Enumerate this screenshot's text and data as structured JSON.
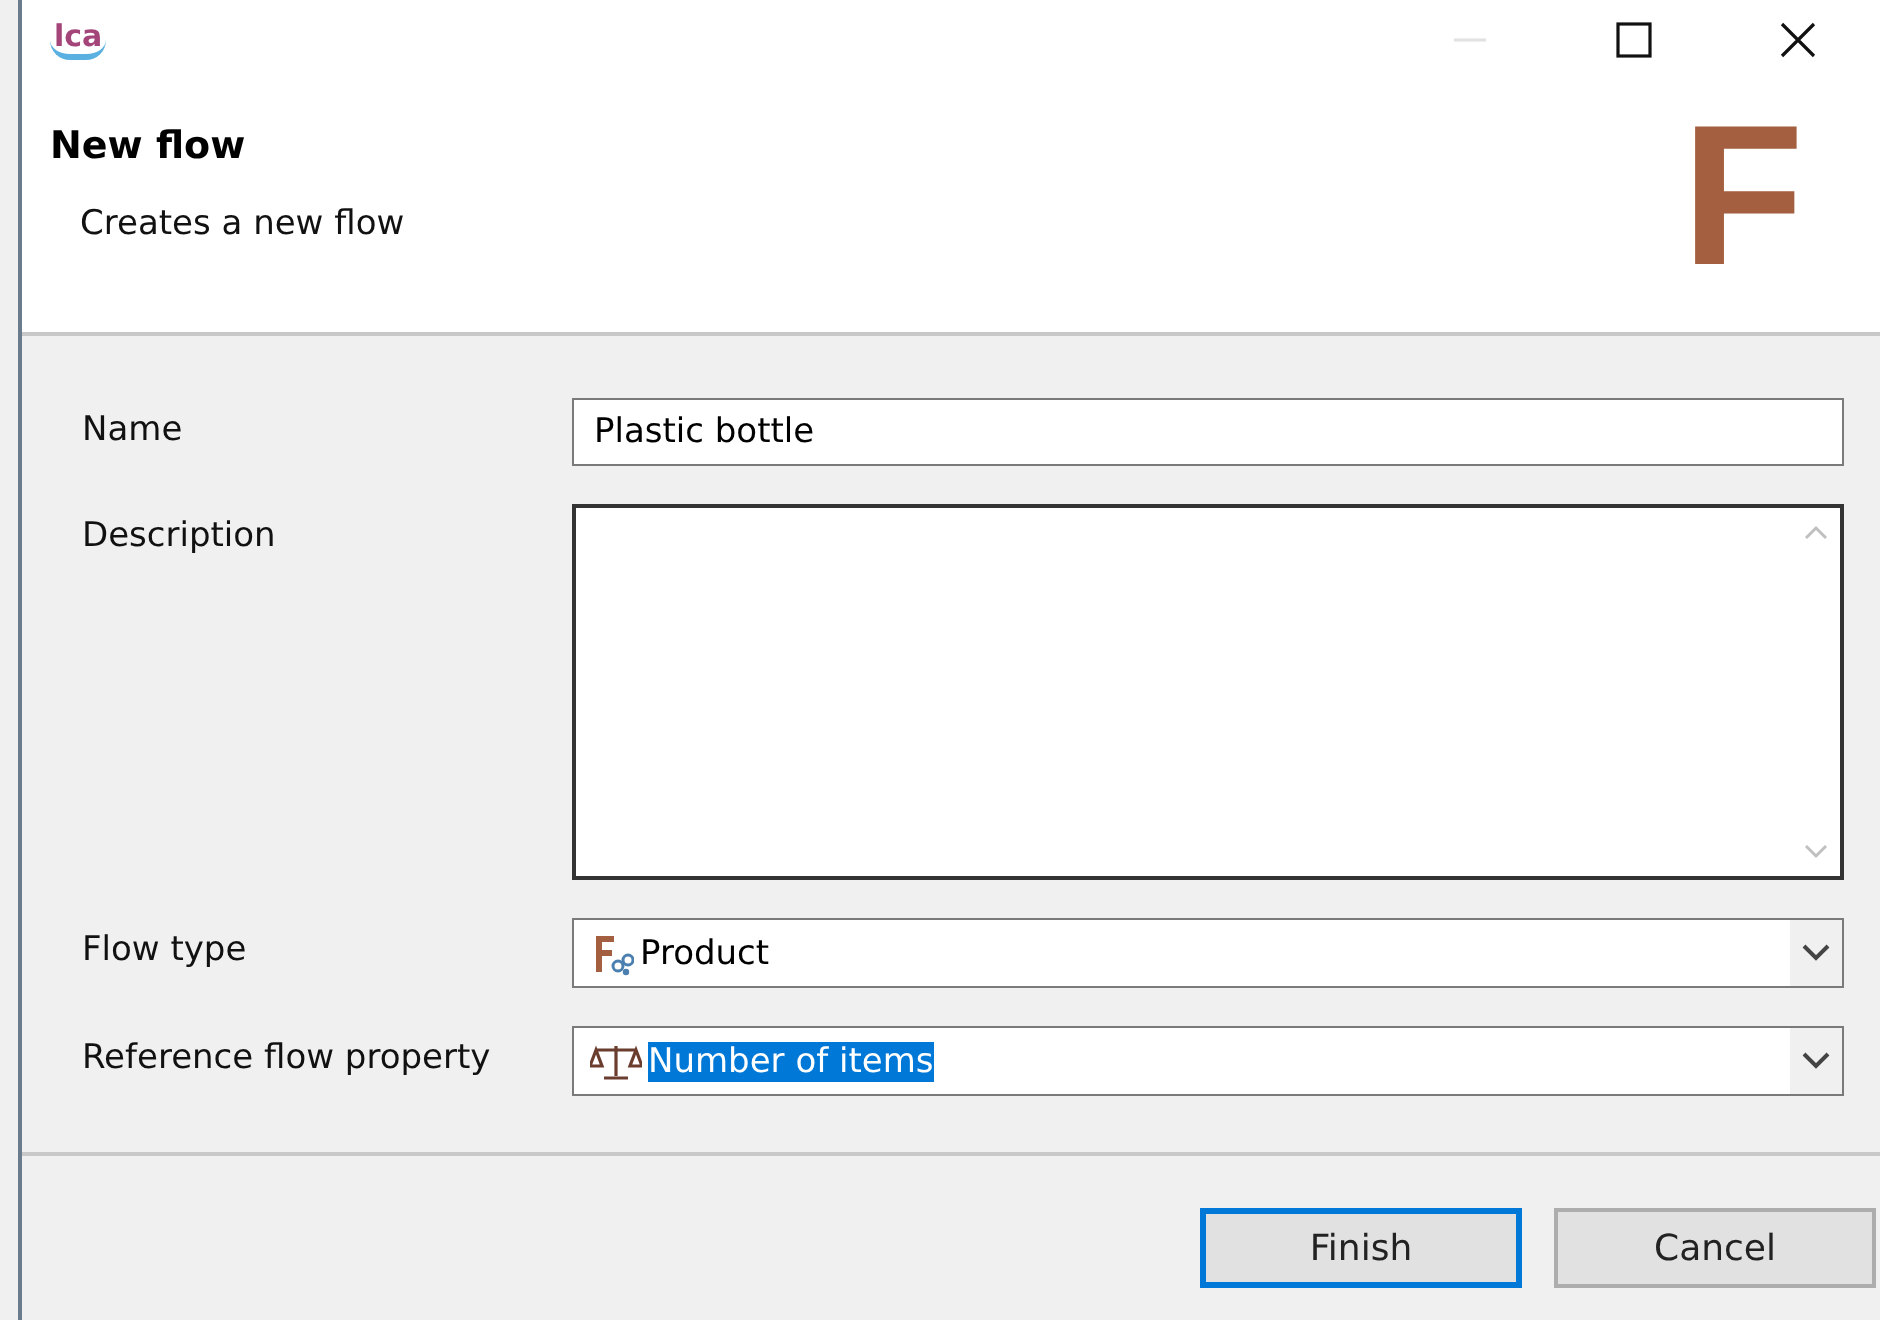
{
  "window": {
    "logo": "lca",
    "controls": [
      {
        "kind": "minimize",
        "disabled": true
      },
      {
        "kind": "maximize",
        "disabled": false
      },
      {
        "kind": "close",
        "disabled": false
      }
    ]
  },
  "header": {
    "title": "New flow",
    "subtitle": "Creates a new flow",
    "banner_letter": "F"
  },
  "fields": [
    {
      "kind": "text",
      "label": "Name",
      "value": "Plastic bottle"
    },
    {
      "kind": "textarea",
      "label": "Description"
    },
    {
      "kind": "combo",
      "label": "Flow type",
      "value": "Product",
      "text_selected": false
    },
    {
      "kind": "combo",
      "label": "Reference flow property",
      "value": "Number of items",
      "text_selected": true
    }
  ],
  "buttons": [
    {
      "label": "Finish",
      "default": true
    },
    {
      "label": "Cancel",
      "default": false
    }
  ]
}
